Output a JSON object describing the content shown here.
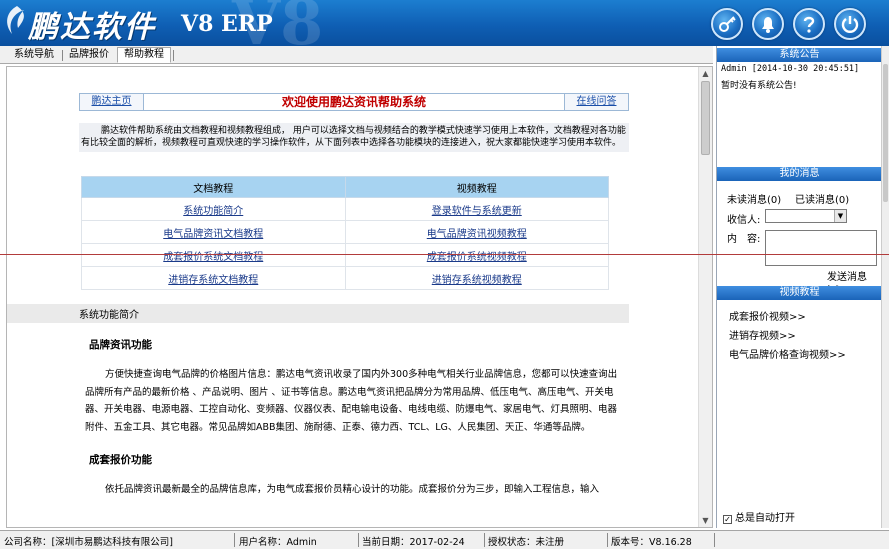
{
  "header": {
    "logo_text": "鹏达软件",
    "product_label": "V8 ERP",
    "watermark": "V8",
    "buttons": [
      "key-icon",
      "bell-icon",
      "question-icon",
      "power-icon"
    ]
  },
  "tabs": [
    {
      "label": "系统导航"
    },
    {
      "label": "品牌报价"
    },
    {
      "label": "帮助教程",
      "active": true
    }
  ],
  "doc": {
    "home_link": "鹏达主页",
    "title": "欢迎使用鹏达资讯帮助系统",
    "qa_link": "在线问答",
    "intro": "鹏达软件帮助系统由文档教程和视频教程组成， 用户可以选择文档与视频结合的教学模式快速学习使用上本软件，文档教程对各功能有比较全面的解析，视频教程可直观快速的学习操作软件，从下面列表中选择各功能模块的连接进入，祝大家都能快速学习使用本软件。",
    "table": {
      "headers": [
        "文档教程",
        "视频教程"
      ],
      "rows": [
        [
          "系统功能简介",
          "登录软件与系统更新"
        ],
        [
          "电气品牌资讯文档教程",
          "电气品牌资讯视频教程"
        ],
        [
          "成套报价系统文档教程",
          "成套报价系统视频教程"
        ],
        [
          "进销存系统文档教程",
          "进销存系统视频教程"
        ]
      ]
    },
    "section_title": "系统功能简介",
    "sec1_heading": "品牌资讯功能",
    "sec1_text": "方便快捷查询电气品牌的价格图片信息：鹏达电气资讯收录了国内外300多种电气相关行业品牌信息，您都可以快速查询出品牌所有产品的最新价格 、产品说明、图片 、证书等信息。鹏达电气资讯把品牌分为常用品牌、低压电气、高压电气、开关电器、开关电器、电源电器、工控自动化、变频器、仪器仪表、配电输电设备、电线电缆、防爆电气、家居电气、灯具照明、电器附件、五金工具、其它电器。常见品牌如ABB集团、施耐德、正泰、德力西、TCL、LG、人民集团、天正、华通等品牌。",
    "sec2_heading": "成套报价功能",
    "sec2_text": "依托品牌资讯最新最全的品牌信息库，为电气成套报价员精心设计的功能。成套报价分为三步，即输入工程信息，输入"
  },
  "right": {
    "notice_title": "系统公告",
    "notice_meta": "Admin [2014-10-30 20:45:51]",
    "notice_text": "暂时没有系统公告!",
    "msg_title": "我的消息",
    "unread": "未读消息(0)",
    "read": "已读消息(0)",
    "recipient_label": "收信人:",
    "content_label": "内　容:",
    "send_label": "发送消息>>",
    "video_title": "视频教程",
    "videos": [
      "成套报价视频>>",
      "进销存视频>>",
      "电气品牌价格查询视频>>"
    ],
    "auto_open_label": "总是自动打开",
    "auto_open_checked": true
  },
  "status": {
    "company": "公司名称：[深圳市易鹏达科技有限公司]",
    "user": "用户名称：Admin",
    "date": "当前日期：2017-02-24",
    "license": "授权状态：未注册",
    "version": "版本号：V8.16.28"
  },
  "colors": {
    "header_blue": "#0f5fb4",
    "title_red": "#c00000",
    "table_header": "#a7d3f1",
    "link_blue": "#1a3a8a"
  }
}
